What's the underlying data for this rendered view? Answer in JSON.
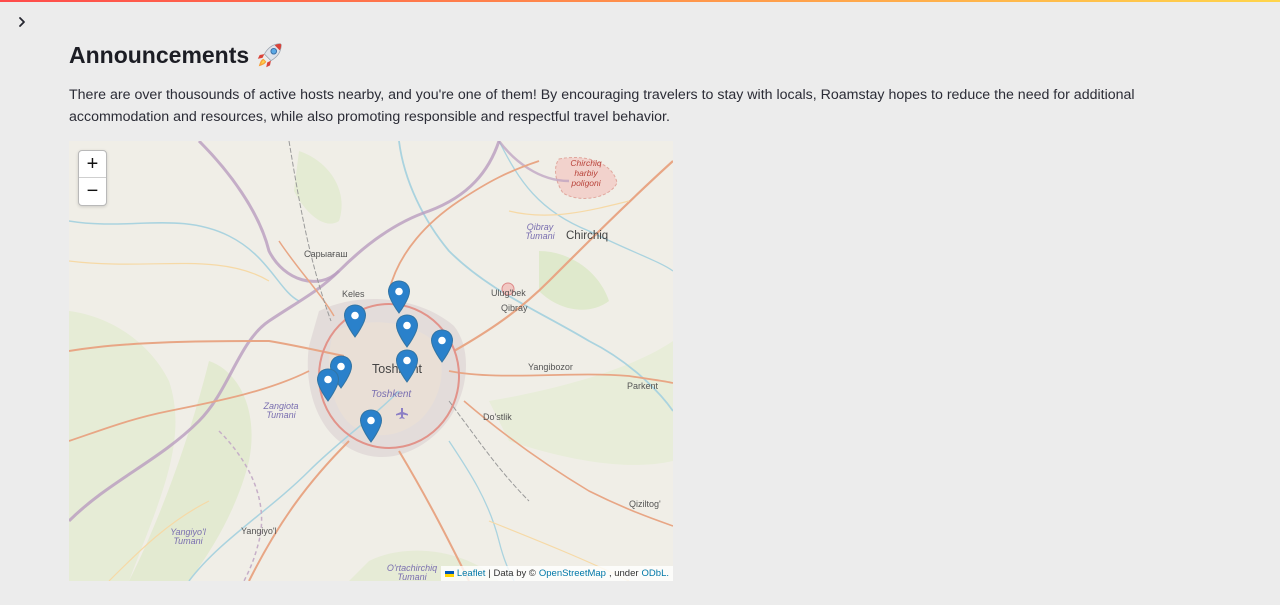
{
  "sidebar": {
    "toggle_icon": "chevron-right-icon"
  },
  "header": {
    "title": "Announcements",
    "title_icon": "rocket-icon"
  },
  "description": "There are over thousounds of active hosts nearby, and you're one of them! By encouraging travelers to stay with locals, Roamstay hopes to reduce the need for additional accommodation and resources, while also promoting responsible and respectful travel behavior.",
  "map": {
    "zoom_in_label": "+",
    "zoom_out_label": "−",
    "marker_count": 9,
    "marker_color": "#2a81cb",
    "labels": {
      "chirchiq_poligon": [
        "Chirchiq",
        "harbiy",
        "poligoni"
      ],
      "chirchiq": "Chirchiq",
      "qibray_tumani": [
        "Qibray",
        "Tumani"
      ],
      "sarygash": "Сарыағаш",
      "keles": "Keles",
      "ulugbek": "Ulug'bek",
      "qibray": "Qibray",
      "toshkent": "Toshkent",
      "toshkent_district": "Toshkent",
      "yangibozor": "Yangibozor",
      "parkent": "Parkent",
      "zangiota": [
        "Zangiota",
        "Tumani"
      ],
      "dostlik": "Do'stlik",
      "qiziltog": "Qiziltog'",
      "yangiyol_tumani": [
        "Yangiyo'l",
        "Tumani"
      ],
      "yangiyol": "Yangiyo'l",
      "ortachirchiq": [
        "O'rtachirchiq",
        "Tumani"
      ]
    },
    "attribution": {
      "leaflet": "Leaflet",
      "separator": "| Data by ©",
      "osm": "OpenStreetMap",
      "under": ", under",
      "license": "ODbL."
    }
  }
}
